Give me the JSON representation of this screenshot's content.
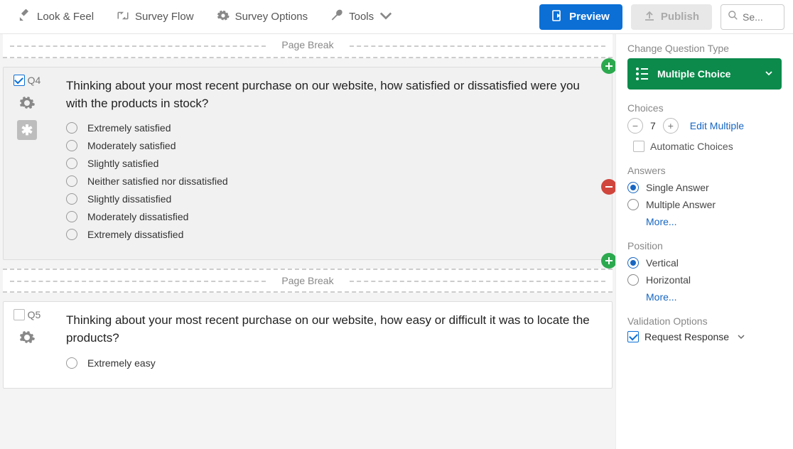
{
  "toolbar": {
    "look_feel": "Look & Feel",
    "survey_flow": "Survey Flow",
    "survey_options": "Survey Options",
    "tools": "Tools",
    "preview": "Preview",
    "publish": "Publish",
    "search_placeholder": "Se..."
  },
  "page_break": "Page Break",
  "q4": {
    "num": "Q4",
    "text": "Thinking about your most recent purchase on our website, how satisfied or dissatisfied were you with the products in stock?",
    "choices": [
      "Extremely satisfied",
      "Moderately satisfied",
      "Slightly satisfied",
      "Neither satisfied nor dissatisfied",
      "Slightly dissatisfied",
      "Moderately dissatisfied",
      "Extremely dissatisfied"
    ]
  },
  "q5": {
    "num": "Q5",
    "text": "Thinking about your most recent purchase on our website, how easy or difficult it was to locate the products?",
    "choices": [
      "Extremely easy"
    ]
  },
  "sidepanel": {
    "change_label": "Change Question Type",
    "qtype": "Multiple Choice",
    "choices_label": "Choices",
    "choice_count": "7",
    "edit_multiple": "Edit Multiple",
    "automatic_choices": "Automatic Choices",
    "answers_label": "Answers",
    "single_answer": "Single Answer",
    "multiple_answer": "Multiple Answer",
    "more": "More...",
    "position_label": "Position",
    "vertical": "Vertical",
    "horizontal": "Horizontal",
    "validation_label": "Validation Options",
    "request_response": "Request Response"
  }
}
